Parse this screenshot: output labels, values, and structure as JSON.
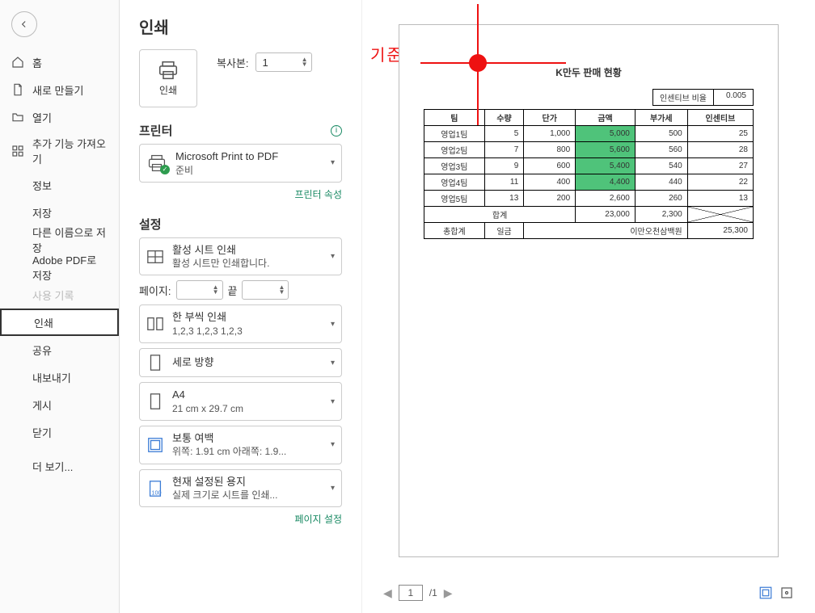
{
  "sidebar": {
    "back": "뒤로",
    "items": [
      {
        "label": "홈"
      },
      {
        "label": "새로 만들기"
      },
      {
        "label": "열기"
      },
      {
        "label": "추가 기능 가져오기"
      },
      {
        "label": "정보"
      },
      {
        "label": "저장"
      },
      {
        "label": "다른 이름으로 저장"
      },
      {
        "label": "Adobe PDF로 저장"
      },
      {
        "label": "사용 기록"
      },
      {
        "label": "인쇄"
      },
      {
        "label": "공유"
      },
      {
        "label": "내보내기"
      },
      {
        "label": "게시"
      },
      {
        "label": "닫기"
      },
      {
        "label": "더 보기..."
      }
    ]
  },
  "title": "인쇄",
  "printbtn": {
    "label": "인쇄"
  },
  "copies": {
    "label": "복사본:",
    "value": "1"
  },
  "printer_section": "프린터",
  "printer": {
    "name": "Microsoft Print to PDF",
    "status": "준비"
  },
  "printer_props_link": "프린터 속성",
  "settings_section": "설정",
  "settings": {
    "activesheet": {
      "t1": "활성 시트 인쇄",
      "t2": "활성 시트만 인쇄합니다."
    },
    "pages": {
      "label": "페이지:",
      "to": "끝",
      "from": "",
      "toval": ""
    },
    "collate": {
      "t1": "한 부씩 인쇄",
      "t2": "1,2,3    1,2,3    1,2,3"
    },
    "orient": {
      "t1": "세로 방향"
    },
    "paper": {
      "t1": "A4",
      "t2": "21 cm x 29.7 cm"
    },
    "margins": {
      "t1": "보통 여백",
      "t2": "위쪽: 1.91 cm 아래쪽: 1.9..."
    },
    "scaling": {
      "t1": "현재 설정된 용지",
      "t2": "실제 크기로 시트를 인쇄..."
    }
  },
  "page_setup_link": "페이지 설정",
  "annotation": "기준점",
  "doc": {
    "title": "K만두 판매 현황",
    "rate_label": "인센티브 비율",
    "rate_value": "0.005",
    "headers": [
      "팀",
      "수량",
      "단가",
      "금액",
      "부가세",
      "인센티브"
    ],
    "rows": [
      {
        "team": "영업1팀",
        "qty": "5",
        "price": "1,000",
        "amt": "5,000",
        "vat": "500",
        "inc": "25",
        "hl": true
      },
      {
        "team": "영업2팀",
        "qty": "7",
        "price": "800",
        "amt": "5,600",
        "vat": "560",
        "inc": "28",
        "hl": true
      },
      {
        "team": "영업3팀",
        "qty": "9",
        "price": "600",
        "amt": "5,400",
        "vat": "540",
        "inc": "27",
        "hl": true
      },
      {
        "team": "영업4팀",
        "qty": "11",
        "price": "400",
        "amt": "4,400",
        "vat": "440",
        "inc": "22",
        "hl": true
      },
      {
        "team": "영업5팀",
        "qty": "13",
        "price": "200",
        "amt": "2,600",
        "vat": "260",
        "inc": "13",
        "hl": false
      }
    ],
    "subtotal": {
      "label": "합계",
      "amt": "23,000",
      "vat": "2,300"
    },
    "grand": {
      "label": "총합계",
      "unit": "일금",
      "text": "이만오천삼백원",
      "val": "25,300"
    }
  },
  "nav": {
    "page": "1",
    "total": "/1"
  }
}
